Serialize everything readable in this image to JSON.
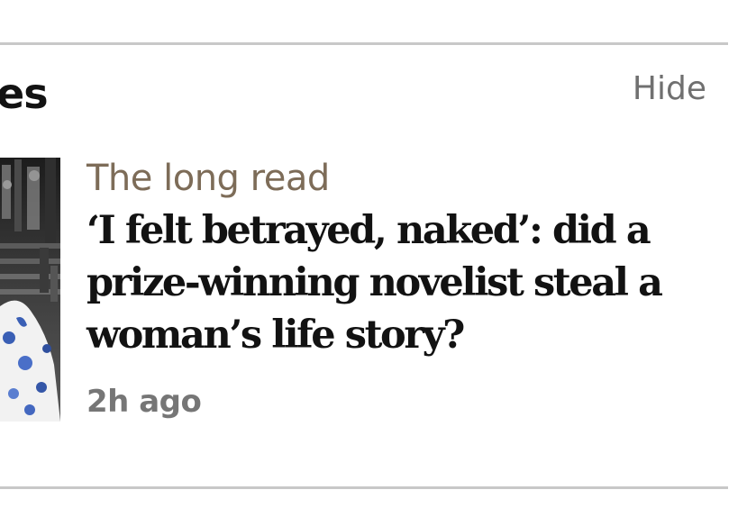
{
  "section": {
    "title_visible_fragment": "es",
    "hide_label": "Hide"
  },
  "article": {
    "kicker": "The long read",
    "headline": "‘I felt betrayed, naked’: did a prize-winning novelist steal a woman’s life story?",
    "timestamp": "2h ago",
    "thumbnail": "article-photo"
  },
  "colors": {
    "kicker": "#7d6c58",
    "headline": "#121212",
    "meta": "#767676",
    "divider": "#c8c8c8"
  }
}
